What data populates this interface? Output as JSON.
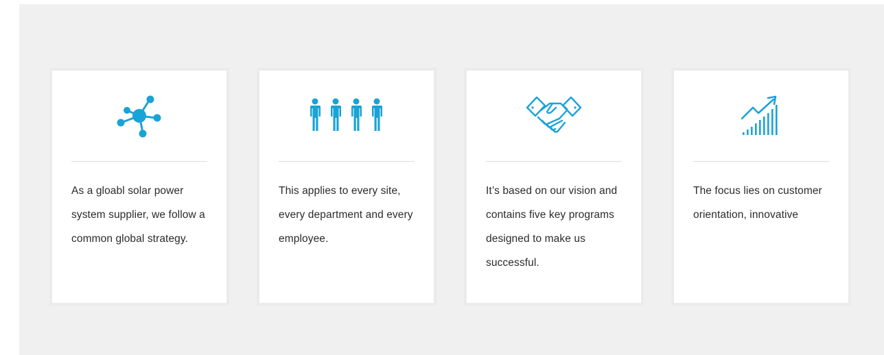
{
  "accent_color": "#1aa3d6",
  "cards": [
    {
      "icon": "network-icon",
      "text": "As a gloabl solar power system supplier, we follow a common global strategy."
    },
    {
      "icon": "people-icon",
      "text": "This applies to every site, every department and every employee."
    },
    {
      "icon": "handshake-icon",
      "text": "It’s based on our vision and contains five key programs designed to make us successful."
    },
    {
      "icon": "growth-chart-icon",
      "text": "The focus lies on customer orientation, innovative"
    }
  ]
}
